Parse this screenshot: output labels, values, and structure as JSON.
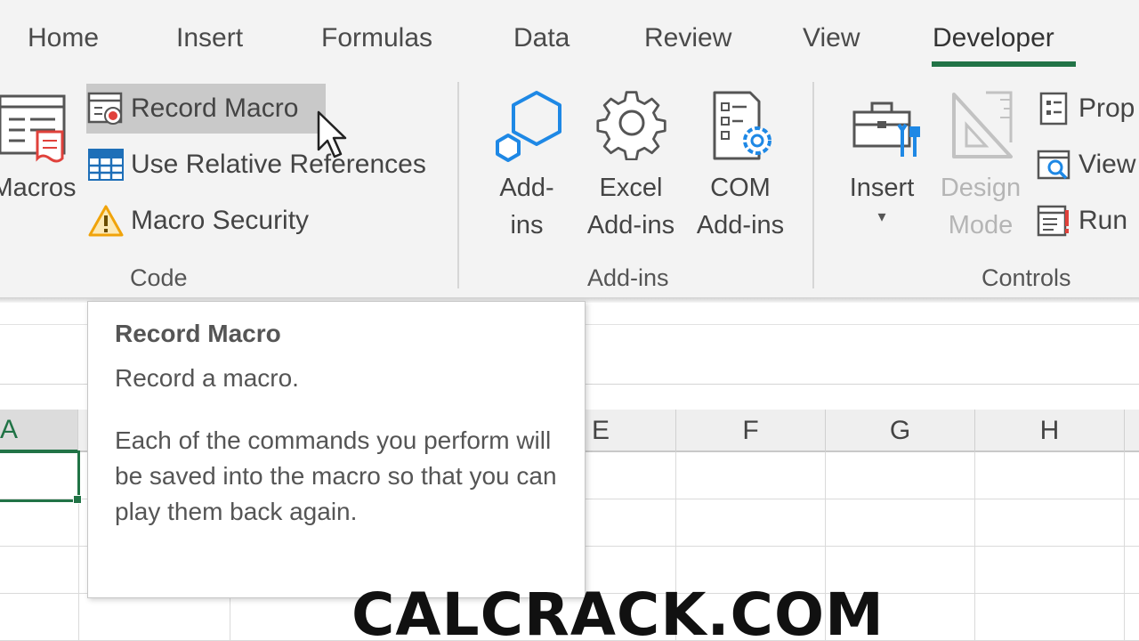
{
  "tabs": [
    {
      "label": "Home"
    },
    {
      "label": "Insert"
    },
    {
      "label": "Formulas"
    },
    {
      "label": "Data"
    },
    {
      "label": "Review"
    },
    {
      "label": "View"
    },
    {
      "label": "Developer",
      "active": true
    }
  ],
  "ribbon": {
    "code": {
      "group_label": "Code",
      "macros_label": "Macros",
      "record_macro_label": "Record Macro",
      "relative_refs_label": "Use Relative References",
      "macro_security_label": "Macro Security"
    },
    "addins": {
      "group_label": "Add-ins",
      "addins_line1": "Add-",
      "addins_line2": "ins",
      "excel_line1": "Excel",
      "excel_line2": "Add-ins",
      "com_line1": "COM",
      "com_line2": "Add-ins"
    },
    "controls": {
      "group_label": "Controls",
      "insert_label": "Insert",
      "design_line1": "Design",
      "design_line2": "Mode",
      "properties_label": "Prop",
      "view_code_label": "View",
      "run_dialog_label": "Run"
    }
  },
  "sheet": {
    "columns": [
      "A",
      "E",
      "F",
      "G",
      "H"
    ],
    "active_cell_column": "A"
  },
  "tooltip": {
    "title": "Record Macro",
    "subtitle": "Record a macro.",
    "body": "Each of the commands you perform will be saved into the macro so that you can play them back again."
  },
  "watermark": "CALCRACK.COM",
  "colors": {
    "accent": "#217346",
    "ribbon_bg": "#f3f3f3",
    "warning": "#f0a30a",
    "icon_blue": "#1e88e5"
  }
}
